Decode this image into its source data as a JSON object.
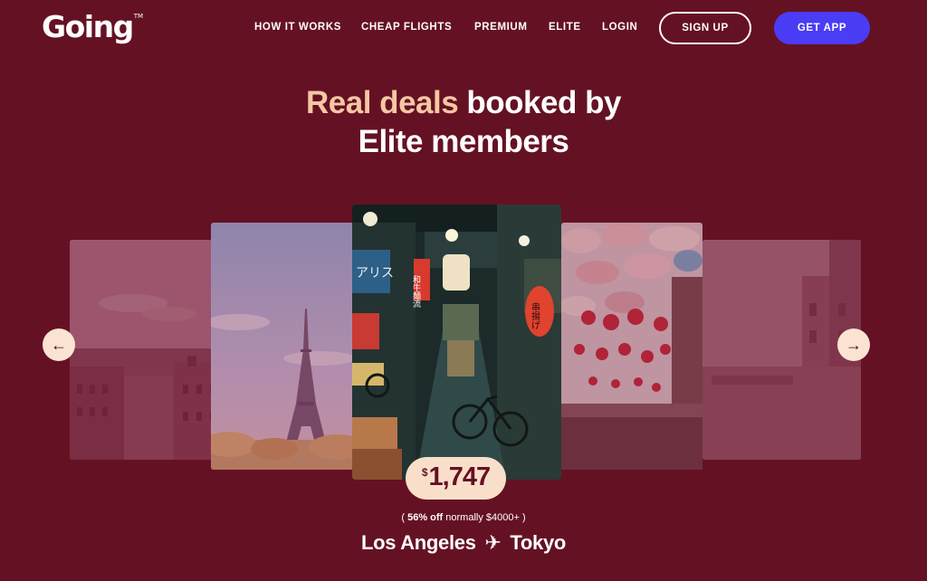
{
  "brand": {
    "name": "Going",
    "tm": "TM"
  },
  "nav": {
    "links": [
      "HOW IT WORKS",
      "CHEAP FLIGHTS",
      "PREMIUM",
      "ELITE",
      "LOGIN"
    ],
    "signup_label": "SIGN UP",
    "getapp_label": "GET APP"
  },
  "hero": {
    "accent": "Real deals",
    "rest": "booked by",
    "line2": "Elite members"
  },
  "carousel": {
    "prev_icon": "arrow-left-icon",
    "next_icon": "arrow-right-icon",
    "prev_glyph": "←",
    "next_glyph": "→",
    "featured": {
      "currency": "$",
      "price": "1,747",
      "discount_open": "( ",
      "discount_bold": "56% off",
      "discount_rest": " normally $4000+ )",
      "origin": "Los Angeles",
      "plane_glyph": "✈",
      "destination": "Tokyo"
    },
    "sign_texts": {
      "left_sign": "アリス",
      "vertical_sign": "和牛麺流",
      "lantern": "串揚げ"
    }
  },
  "colors": {
    "background": "#651124",
    "accent": "#f6c7a4",
    "cta": "#4b3cf5",
    "pill": "#f9dfca"
  }
}
